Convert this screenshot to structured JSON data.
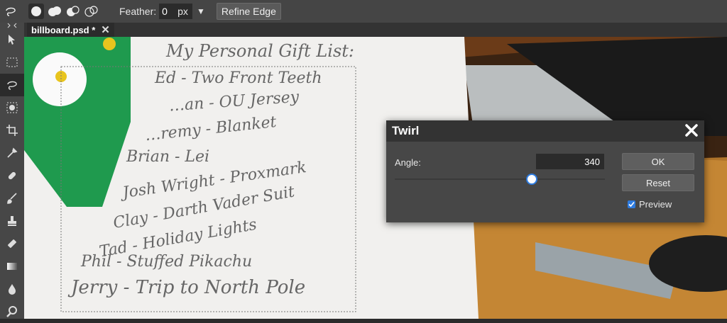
{
  "options_bar": {
    "feather_label": "Feather:",
    "feather_value": "0",
    "feather_unit": "px",
    "refine_edge_label": "Refine Edge",
    "icons": [
      "lasso-icon",
      "new-selection-icon",
      "add-selection-icon",
      "subtract-selection-icon",
      "intersect-selection-icon"
    ]
  },
  "document_tab": {
    "title": "billboard.psd *"
  },
  "toolbar": {
    "tools": [
      "move-tool-icon",
      "marquee-tool-icon",
      "lasso-tool-icon",
      "quick-select-tool-icon",
      "crop-tool-icon",
      "eyedropper-tool-icon",
      "healing-tool-icon",
      "brush-tool-icon",
      "stamp-tool-icon",
      "eraser-tool-icon",
      "gradient-tool-icon",
      "blur-tool-icon",
      "zoom-tool-icon"
    ],
    "selected": "lasso-tool-icon"
  },
  "canvas": {
    "paper_heading": "My Personal Gift List:",
    "list_items": [
      "Ed - Two Front Teeth",
      "…an - OU Jersey",
      "…remy - Blanket",
      "Brian - Lei",
      "Josh Wright - Proxmark",
      "Clay - Darth Vader Suit",
      "Tad - Holiday Lights",
      "Phil - Stuffed Pikachu",
      "Jerry - Trip to North Pole"
    ]
  },
  "twirl_dialog": {
    "title": "Twirl",
    "angle_label": "Angle:",
    "angle_value": "340",
    "ok_label": "OK",
    "reset_label": "Reset",
    "preview_label": "Preview",
    "preview_checked": true,
    "accent_color": "#2d7be0"
  }
}
